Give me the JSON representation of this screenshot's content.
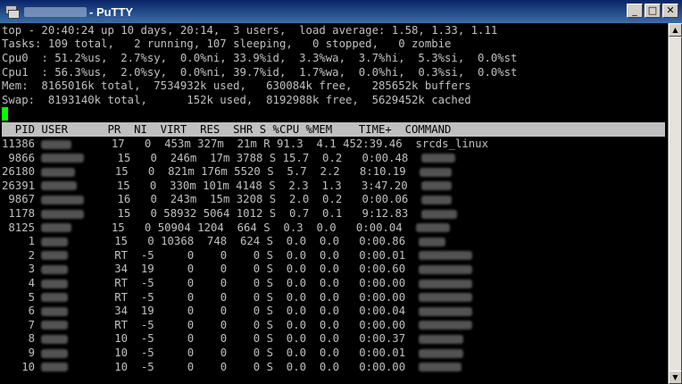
{
  "window": {
    "title": "- PuTTY",
    "buttons": {
      "minimize": "_",
      "maximize": "□",
      "close": "✕"
    }
  },
  "summary": [
    "top - 20:40:24 up 10 days, 20:14,  3 users,  load average: 1.58, 1.33, 1.11",
    "Tasks: 109 total,   2 running, 107 sleeping,   0 stopped,   0 zombie",
    "Cpu0  : 51.2%us,  2.7%sy,  0.0%ni, 33.9%id,  3.3%wa,  3.7%hi,  5.3%si,  0.0%st",
    "Cpu1  : 56.3%us,  2.0%sy,  0.0%ni, 39.7%id,  1.7%wa,  0.0%hi,  0.3%si,  0.0%st",
    "Mem:  8165016k total,  7534932k used,   630084k free,   285652k buffers",
    "Swap:  8193140k total,      152k used,  8192988k free,  5629452k cached"
  ],
  "table_header": "  PID USER      PR  NI  VIRT  RES  SHR S %CPU %MEM    TIME+  COMMAND",
  "processes": [
    {
      "pid": "11386",
      "pr": "17",
      "ni": "0",
      "virt": "453m",
      "res": "327m",
      "shr": "21m",
      "s": "R",
      "cpu": "91.3",
      "mem": "4.1",
      "time": "452:39.46",
      "cmd": "srcds_linux"
    },
    {
      "pid": "9866",
      "pr": "15",
      "ni": "0",
      "virt": "246m",
      "res": "17m",
      "shr": "3788",
      "s": "S",
      "cpu": "15.7",
      "mem": "0.2",
      "time": "0:00.48",
      "cmd": ""
    },
    {
      "pid": "26180",
      "pr": "15",
      "ni": "0",
      "virt": "821m",
      "res": "176m",
      "shr": "5520",
      "s": "S",
      "cpu": "5.7",
      "mem": "2.2",
      "time": "8:10.19",
      "cmd": ""
    },
    {
      "pid": "26391",
      "pr": "15",
      "ni": "0",
      "virt": "330m",
      "res": "101m",
      "shr": "4148",
      "s": "S",
      "cpu": "2.3",
      "mem": "1.3",
      "time": "3:47.20",
      "cmd": ""
    },
    {
      "pid": "9867",
      "pr": "16",
      "ni": "0",
      "virt": "243m",
      "res": "15m",
      "shr": "3208",
      "s": "S",
      "cpu": "2.0",
      "mem": "0.2",
      "time": "0:00.06",
      "cmd": ""
    },
    {
      "pid": "1178",
      "pr": "15",
      "ni": "0",
      "virt": "58932",
      "res": "5064",
      "shr": "1012",
      "s": "S",
      "cpu": "0.7",
      "mem": "0.1",
      "time": "9:12.83",
      "cmd": ""
    },
    {
      "pid": "8125",
      "pr": "15",
      "ni": "0",
      "virt": "50904",
      "res": "1204",
      "shr": "664",
      "s": "S",
      "cpu": "0.3",
      "mem": "0.0",
      "time": "0:00.04",
      "cmd": ""
    },
    {
      "pid": "1",
      "pr": "15",
      "ni": "0",
      "virt": "10368",
      "res": "748",
      "shr": "624",
      "s": "S",
      "cpu": "0.0",
      "mem": "0.0",
      "time": "0:00.86",
      "cmd": ""
    },
    {
      "pid": "2",
      "pr": "RT",
      "ni": "-5",
      "virt": "0",
      "res": "0",
      "shr": "0",
      "s": "S",
      "cpu": "0.0",
      "mem": "0.0",
      "time": "0:00.01",
      "cmd": ""
    },
    {
      "pid": "3",
      "pr": "34",
      "ni": "19",
      "virt": "0",
      "res": "0",
      "shr": "0",
      "s": "S",
      "cpu": "0.0",
      "mem": "0.0",
      "time": "0:00.60",
      "cmd": ""
    },
    {
      "pid": "4",
      "pr": "RT",
      "ni": "-5",
      "virt": "0",
      "res": "0",
      "shr": "0",
      "s": "S",
      "cpu": "0.0",
      "mem": "0.0",
      "time": "0:00.00",
      "cmd": ""
    },
    {
      "pid": "5",
      "pr": "RT",
      "ni": "-5",
      "virt": "0",
      "res": "0",
      "shr": "0",
      "s": "S",
      "cpu": "0.0",
      "mem": "0.0",
      "time": "0:00.00",
      "cmd": ""
    },
    {
      "pid": "6",
      "pr": "34",
      "ni": "19",
      "virt": "0",
      "res": "0",
      "shr": "0",
      "s": "S",
      "cpu": "0.0",
      "mem": "0.0",
      "time": "0:00.04",
      "cmd": ""
    },
    {
      "pid": "7",
      "pr": "RT",
      "ni": "-5",
      "virt": "0",
      "res": "0",
      "shr": "0",
      "s": "S",
      "cpu": "0.0",
      "mem": "0.0",
      "time": "0:00.00",
      "cmd": ""
    },
    {
      "pid": "8",
      "pr": "10",
      "ni": "-5",
      "virt": "0",
      "res": "0",
      "shr": "0",
      "s": "S",
      "cpu": "0.0",
      "mem": "0.0",
      "time": "0:00.37",
      "cmd": ""
    },
    {
      "pid": "9",
      "pr": "10",
      "ni": "-5",
      "virt": "0",
      "res": "0",
      "shr": "0",
      "s": "S",
      "cpu": "0.0",
      "mem": "0.0",
      "time": "0:00.01",
      "cmd": ""
    },
    {
      "pid": "10",
      "pr": "10",
      "ni": "-5",
      "virt": "0",
      "res": "0",
      "shr": "0",
      "s": "S",
      "cpu": "0.0",
      "mem": "0.0",
      "time": "0:00.00",
      "cmd": ""
    }
  ],
  "colors": {
    "terminal_bg": "#000000",
    "terminal_fg": "#c0c0c0",
    "header_bar": "#c0c0c0",
    "cursor": "#00ff00",
    "titlebar": "#0a246a"
  }
}
